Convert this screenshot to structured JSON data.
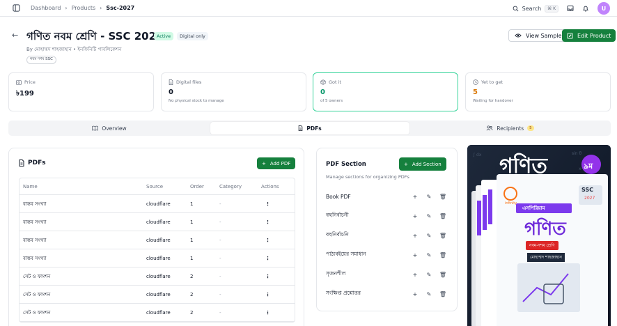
{
  "topbar": {
    "breadcrumbs": [
      "Dashboard",
      "Products",
      "Ssc-2027"
    ],
    "search_label": "Search",
    "search_shortcut": "⌘ K",
    "avatar_initial": "U"
  },
  "header": {
    "title": "গণিত নবম শ্রেণি - SSC 2027",
    "status_badge": "Active",
    "type_badge": "Digital only",
    "byline": "By মোহাম্মদ শাহজাহান • ইনফিনিটি পাবলিকেশন",
    "tag": "নবম দশম SSC",
    "view_sample_label": "View Sample",
    "edit_label": "Edit Product"
  },
  "stats": [
    {
      "label": "Price",
      "value": "৳199",
      "sub": "",
      "icon": "tag-icon"
    },
    {
      "label": "Digital files",
      "value": "0",
      "sub": "No physical stock to manage",
      "icon": "file-icon"
    },
    {
      "label": "Got it",
      "value": "0",
      "sub": "of 5 owners",
      "icon": "package-icon"
    },
    {
      "label": "Yet to get",
      "value": "5",
      "sub": "Waiting for handover",
      "icon": "clock-icon"
    }
  ],
  "tabs": [
    {
      "label": "Overview",
      "icon": "book-icon"
    },
    {
      "label": "PDFs",
      "icon": "file-icon"
    },
    {
      "label": "Recipients",
      "icon": "users-icon",
      "count": "5"
    }
  ],
  "pdfs": {
    "title": "PDFs",
    "add_label": "Add PDF",
    "columns": [
      "Name",
      "Source",
      "Order",
      "Category",
      "Actions"
    ],
    "rows": [
      {
        "name": "বাস্তব সংখ্যা",
        "source": "cloudflare",
        "order": "1",
        "category": "-"
      },
      {
        "name": "বাস্তব সংখ্যা",
        "source": "cloudflare",
        "order": "1",
        "category": "-"
      },
      {
        "name": "বাস্তব সংখ্যা",
        "source": "cloudflare",
        "order": "1",
        "category": "-"
      },
      {
        "name": "বাস্তব সংখ্যা",
        "source": "cloudflare",
        "order": "1",
        "category": "-"
      },
      {
        "name": "সেট ও ফাংশন",
        "source": "cloudflare",
        "order": "2",
        "category": "-"
      },
      {
        "name": "সেট ও ফাংশন",
        "source": "cloudflare",
        "order": "2",
        "category": "-"
      },
      {
        "name": "সেট ও ফাংশন",
        "source": "cloudflare",
        "order": "2",
        "category": "-"
      }
    ]
  },
  "sections": {
    "title": "PDF Section",
    "subtitle": "Manage sections for organizing PDFs",
    "add_label": "Add Section",
    "items": [
      "Book PDF",
      "বহুনির্বাচনী",
      "বহুনির্বাচনি",
      "পাঠ্যবইয়ের সমাধান",
      "সৃজনশীল",
      "সংক্ষিপ্ত প্রশ্নোত্তর"
    ]
  },
  "cover": {
    "title": "গণিত",
    "grade": "৯ম",
    "ssc": "SSC",
    "year": "2027",
    "series": "এসপিরিয়াম",
    "book_title": "গণিত",
    "class_label": "নবম-দশম শ্রেণি",
    "author": "মোহাম্মদ শাহজাহান",
    "brand": "infinity"
  },
  "colors": {
    "accent": "#15803d",
    "active_badge": "#d1fae5",
    "cover_purple": "#7c3aed"
  }
}
